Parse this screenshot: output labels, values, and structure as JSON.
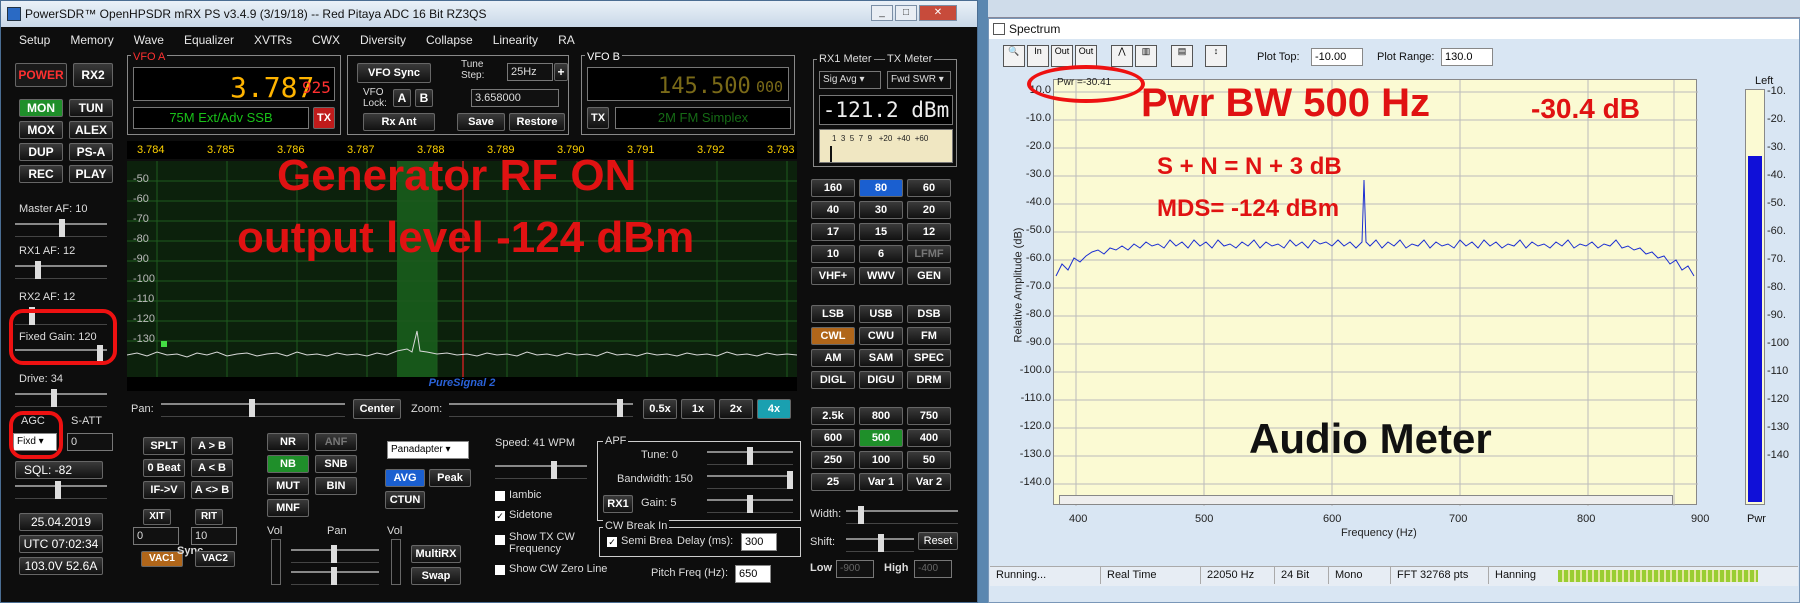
{
  "psdr": {
    "title": "PowerSDR™ OpenHPSDR mRX PS v3.4.9 (3/19/18)   --   Red Pitaya ADC 16 Bit  RZ3QS",
    "menu": [
      "Setup",
      "Memory",
      "Wave",
      "Equalizer",
      "XVTRs",
      "CWX",
      "Diversity",
      "Collapse",
      "Linearity",
      "RA"
    ],
    "power_label": "POWER",
    "rx2_label": "RX2",
    "left_buttons": [
      "MON",
      "TUN",
      "MOX",
      "ALEX",
      "DUP",
      "PS-A",
      "REC",
      "PLAY"
    ],
    "master_af": "Master AF:  10",
    "rx1_af": "RX1 AF:  12",
    "rx2_af": "RX2 AF:  12",
    "fixed_gain": "Fixed Gain:  120",
    "drive": "Drive:  34",
    "agc": "AGC",
    "agc_value": "Fixd",
    "satt": "S-ATT",
    "satt_value": "0",
    "sql": "SQL:  -82",
    "date": "25.04.2019",
    "utc": "UTC 07:02:34",
    "supply": "103.0V 52.6A",
    "vfo_a": {
      "label": "VFO A",
      "freq_main": "3.787",
      "freq_sub": "925",
      "mode": "75M Ext/Adv SSB",
      "tx": "TX"
    },
    "vfo_mid": {
      "sync": "VFO Sync",
      "tune_step_label": "Tune\nStep:",
      "tune_step": "25Hz",
      "lock": "VFO\nLock:",
      "a": "A",
      "b": "B",
      "freq": "3.658000",
      "rx_ant": "Rx Ant",
      "save": "Save",
      "restore": "Restore"
    },
    "vfo_b": {
      "label": "VFO B",
      "freq_main": "145.500",
      "freq_sub": "000",
      "mode": "2M FM Simplex",
      "tx": "TX"
    },
    "rx1_meter": {
      "label": "RX1 Meter",
      "sel": "Sig Avg",
      "tx_label": "TX Meter",
      "tx_sel": "Fwd SWR",
      "reading": "-121.2 dBm",
      "scale": "1  3  5  7  9   +20  +40  +60"
    },
    "freq_axis": [
      "3.784",
      "3.785",
      "3.786",
      "3.787",
      "3.788",
      "3.789",
      "3.790",
      "3.791",
      "3.792",
      "3.793"
    ],
    "db_axis": [
      "-50",
      "-60",
      "-70",
      "-80",
      "-90",
      "-100",
      "-110",
      "-120",
      "-130"
    ],
    "overlay1": "Generator RF ON",
    "overlay2": "output level -124 dBm",
    "puresignal": "PureSignal 2",
    "bands": [
      "160",
      "80",
      "60",
      "40",
      "30",
      "20",
      "17",
      "15",
      "12",
      "10",
      "6",
      "LFMF",
      "VHF+",
      "WWV",
      "GEN"
    ],
    "modes": [
      "LSB",
      "USB",
      "DSB",
      "CWL",
      "CWU",
      "FM",
      "AM",
      "SAM",
      "SPEC",
      "DIGL",
      "DIGU",
      "DRM"
    ],
    "filters": [
      "2.5k",
      "800",
      "750",
      "600",
      "500",
      "400",
      "250",
      "100",
      "50",
      "25",
      "Var 1",
      "Var 2"
    ],
    "pan": "Pan:",
    "center": "Center",
    "zoom": "Zoom:",
    "zoom_btns": [
      "0.5x",
      "1x",
      "2x",
      "4x"
    ],
    "dsp": [
      "NR",
      "ANF",
      "NB",
      "SNB",
      "MUT",
      "BIN",
      "MNF"
    ],
    "display_mode": "Panadapter",
    "avg": "AVG",
    "peak": "Peak",
    "ctun": "CTUN",
    "split_btns": [
      "SPLT",
      "A > B",
      "0 Beat",
      "A < B",
      "IF->V",
      "A <> B"
    ],
    "xit": "XIT",
    "rit": "RIT",
    "xit_val": "0",
    "rit_val": "10",
    "vac1": "VAC1",
    "vac2": "VAC2",
    "sync": "Sync",
    "vol": "Vol",
    "pan2": "Pan",
    "vol2": "Vol",
    "multirx": "MultiRX",
    "swap": "Swap",
    "speed": "Speed:  41 WPM",
    "iambic": "Iambic",
    "sidetone": "Sidetone",
    "show_tx_cw": "Show TX CW Frequency",
    "show_cw_zero": "Show CW Zero Line",
    "apf": {
      "label": "APF",
      "tune": "Tune:  0",
      "bandwidth": "Bandwidth:  150",
      "rx1": "RX1",
      "gain": "Gain:  5"
    },
    "cw_break": {
      "label": "CW Break In",
      "semi": "Semi Brea",
      "delay_label": "Delay (ms):",
      "delay": "300"
    },
    "pitch_label": "Pitch Freq (Hz):",
    "pitch": "650"
  },
  "spectrum": {
    "title": "Spectrum",
    "toolbar_icons": [
      "zoom-icon",
      "in-icon",
      "out-icon",
      "out-icon",
      "peak-icon",
      "bars-icon",
      "save-icon",
      "scale-icon"
    ],
    "plot_top_label": "Plot Top:",
    "plot_top": "-10.00",
    "plot_range_label": "Plot Range:",
    "plot_range": "130.0",
    "left_label": "Left",
    "pwr_readout": "Pwr =-30.41",
    "y_axis": [
      "10.0",
      "-10.0",
      "-20.0",
      "-30.0",
      "-40.0",
      "-50.0",
      "-60.0",
      "-70.0",
      "-80.0",
      "-90.0",
      "-100.0",
      "-110.0",
      "-120.0",
      "-130.0",
      "-140.0"
    ],
    "right_axis": [
      "-10.",
      "-20.",
      "-30.",
      "-40.",
      "-50.",
      "-60.",
      "-70.",
      "-80.",
      "-90.",
      "-100",
      "-110",
      "-120",
      "-130",
      "-140"
    ],
    "x_axis": [
      "400",
      "500",
      "600",
      "700",
      "800",
      "900"
    ],
    "ylabel": "Relative Amplitude (dB)",
    "xlabel": "Frequency (Hz)",
    "pwr_col": "Pwr",
    "overlay_bw": "Pwr BW 500 Hz",
    "overlay_db": "-30.4 dB",
    "overlay_sn": "S + N = N + 3 dB",
    "overlay_mds": "MDS= -124 dBm",
    "overlay_audio": "Audio Meter",
    "width": "Width:",
    "shift": "Shift:",
    "reset": "Reset",
    "low": "Low",
    "low_val": "-900",
    "high": "High",
    "high_val": "-400",
    "status": [
      "Running...",
      "Real Time",
      "22050 Hz",
      "24 Bit",
      "Mono",
      "FFT 32768 pts",
      "Hanning"
    ]
  },
  "colors": {
    "accent_red": "#e01212",
    "vfo_amber": "#ffb400",
    "grid_green": "#1e5a1e",
    "trace_blue": "#1c2fd2"
  }
}
